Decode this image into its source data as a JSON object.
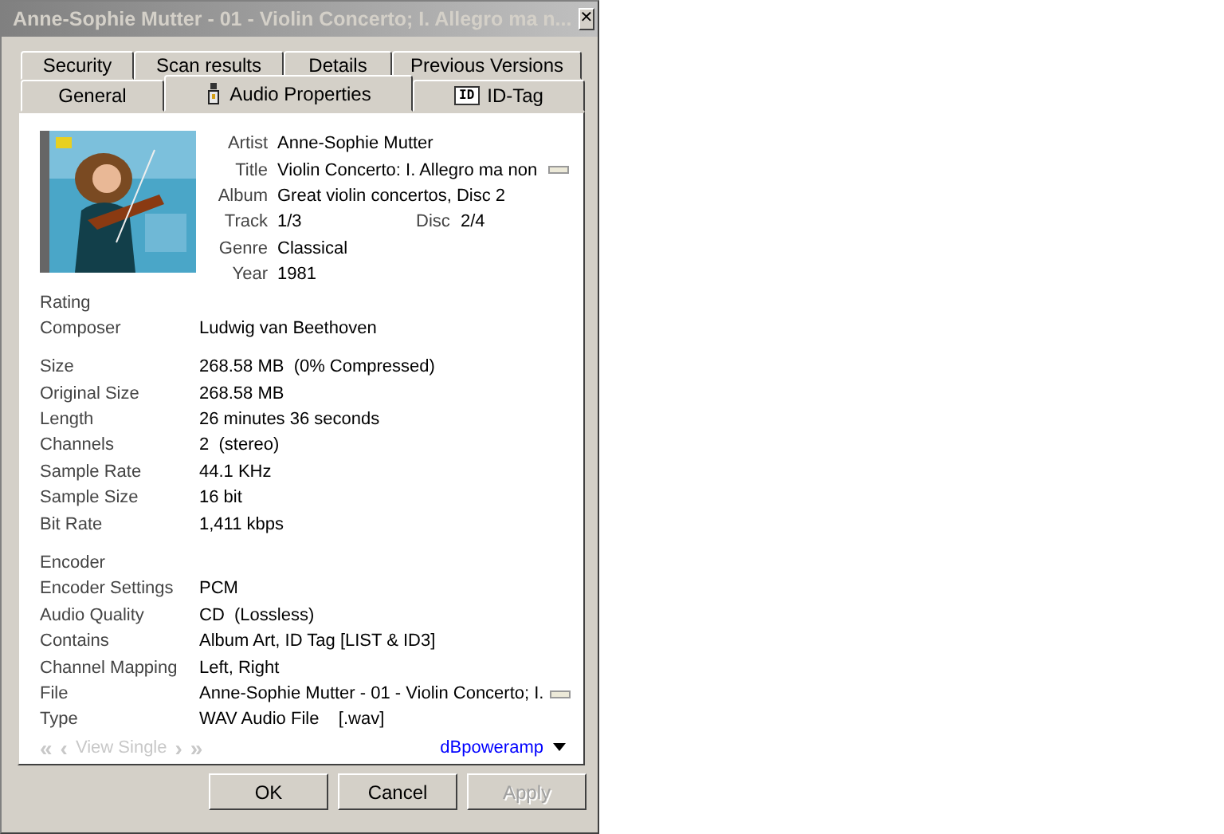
{
  "window": {
    "title": "Anne-Sophie Mutter - 01 - Violin Concerto; I. Allegro ma n...",
    "close": "✕"
  },
  "tab_rows": [
    [
      {
        "label": "Security",
        "selected": false
      },
      {
        "label": "Scan results",
        "selected": false
      },
      {
        "label": "Details",
        "selected": false
      },
      {
        "label": "Previous Versions",
        "selected": false
      }
    ],
    [
      {
        "label": "General",
        "selected": false
      },
      {
        "label": "Audio Properties",
        "selected": true
      },
      {
        "label": "ID-Tag",
        "selected": false,
        "icon_text": "ID"
      }
    ]
  ],
  "cover": {
    "kind": "picture"
  },
  "tags": [
    {
      "label": "Artist",
      "value": "Anne-Sophie Mutter"
    },
    {
      "label": "Title",
      "value": "Violin Concerto: I. Allegro ma non",
      "more": true
    },
    {
      "label": "Album",
      "value": "Great violin concertos, Disc 2"
    },
    {
      "label": "Track",
      "value": "1/3",
      "extra_label": "Disc",
      "extra_value": "2/4"
    },
    {
      "label": "Genre",
      "value": "Classical"
    },
    {
      "label": "Year",
      "value": "1981"
    }
  ],
  "sections": [
    [
      {
        "label": "Rating"
      },
      {
        "label": "Composer",
        "value": "Ludwig van Beethoven"
      }
    ],
    [
      {
        "label": "Size",
        "value": "268.58 MB  (0% Compressed)"
      },
      {
        "label": "Original Size",
        "value": "268.58 MB"
      },
      {
        "label": "Length",
        "value": "26 minutes 36 seconds"
      },
      {
        "label": "Channels",
        "value": "2  (stereo)"
      },
      {
        "label": "Sample Rate",
        "value": "44.1 KHz"
      },
      {
        "label": "Sample Size",
        "value": "16 bit"
      },
      {
        "label": "Bit Rate",
        "value": "1,411 kbps"
      }
    ],
    [
      {
        "label": "Encoder"
      },
      {
        "label": "Encoder Settings",
        "value": "PCM"
      },
      {
        "label": "Audio Quality",
        "value": "CD  (Lossless)"
      },
      {
        "label": "Contains",
        "value": "Album Art, ID Tag [LIST & ID3]"
      },
      {
        "label": "Channel Mapping",
        "value": "Left, Right"
      },
      {
        "label": "File",
        "value": "Anne-Sophie Mutter - 01 - Violin Concerto; I.",
        "more": true
      },
      {
        "label": "Type",
        "value": "WAV Audio File    [.wav]"
      }
    ]
  ],
  "nav": {
    "disabled": true,
    "first": "«",
    "prev": "‹",
    "label": "View Single",
    "next": "›",
    "last": "»"
  },
  "brand_link": "dBpoweramp",
  "buttons": [
    {
      "label": "OK",
      "disabled": false
    },
    {
      "label": "Cancel",
      "disabled": false
    },
    {
      "label": "Apply",
      "disabled": true
    }
  ]
}
